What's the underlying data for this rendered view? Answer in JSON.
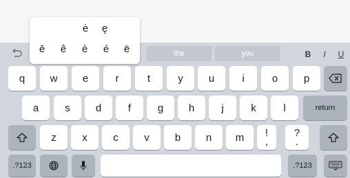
{
  "predictions": [
    "the",
    "you"
  ],
  "toolbar": {
    "bold": "B",
    "italic": "I",
    "underline": "U"
  },
  "accent_popup": {
    "row1": [
      "ė",
      "ę"
    ],
    "row2": [
      "ē",
      "ê",
      "è",
      "é",
      "ë"
    ]
  },
  "rows": {
    "row1": [
      "q",
      "w",
      "e",
      "r",
      "t",
      "y",
      "u",
      "i",
      "o",
      "p"
    ],
    "row2": [
      "a",
      "s",
      "d",
      "f",
      "g",
      "h",
      "j",
      "k",
      "l"
    ],
    "row3": [
      "z",
      "x",
      "c",
      "v",
      "b",
      "n",
      "m",
      "!",
      ",",
      "?",
      "."
    ]
  },
  "keys": {
    "return": "return",
    "numbers_left": ".?123",
    "numbers_right": ".?123"
  },
  "icons": {
    "undo": "undo-icon",
    "delete": "backspace-icon",
    "shift": "shift-icon",
    "globe": "globe-icon",
    "mic": "microphone-icon",
    "dismiss": "keyboard-dismiss-icon"
  }
}
